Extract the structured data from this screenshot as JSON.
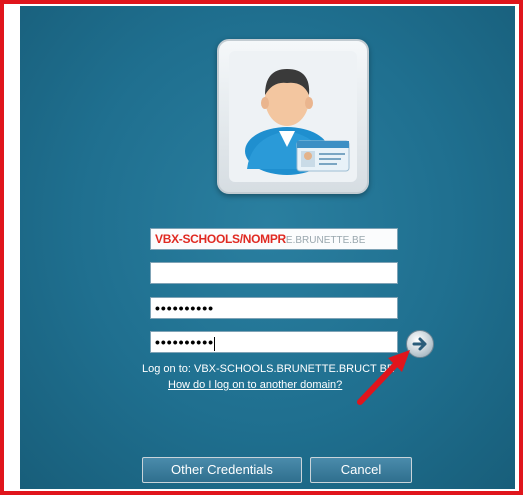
{
  "login": {
    "username_value": "VBX-SCHOOLS/NOMPR",
    "username_obscured_tail": "E.BRUNETTE.BE",
    "field2_value": "",
    "password1_value": "••••••••••",
    "password2_value": "••••••••••",
    "logon_to_text": "Log on to: VBX-SCHOOLS.BRUNETTE.BRUCT BE",
    "other_domain_link": "How do I log on to another domain?"
  },
  "buttons": {
    "other_credentials": "Other Credentials",
    "cancel": "Cancel"
  },
  "icons": {
    "user_tile": "user-with-id-card-icon",
    "submit": "arrow-right-icon",
    "annotation": "red-arrow-icon"
  },
  "colors": {
    "border_red": "#e0151c",
    "panel_blue": "#1e6b89",
    "username_red": "#e02a22"
  }
}
